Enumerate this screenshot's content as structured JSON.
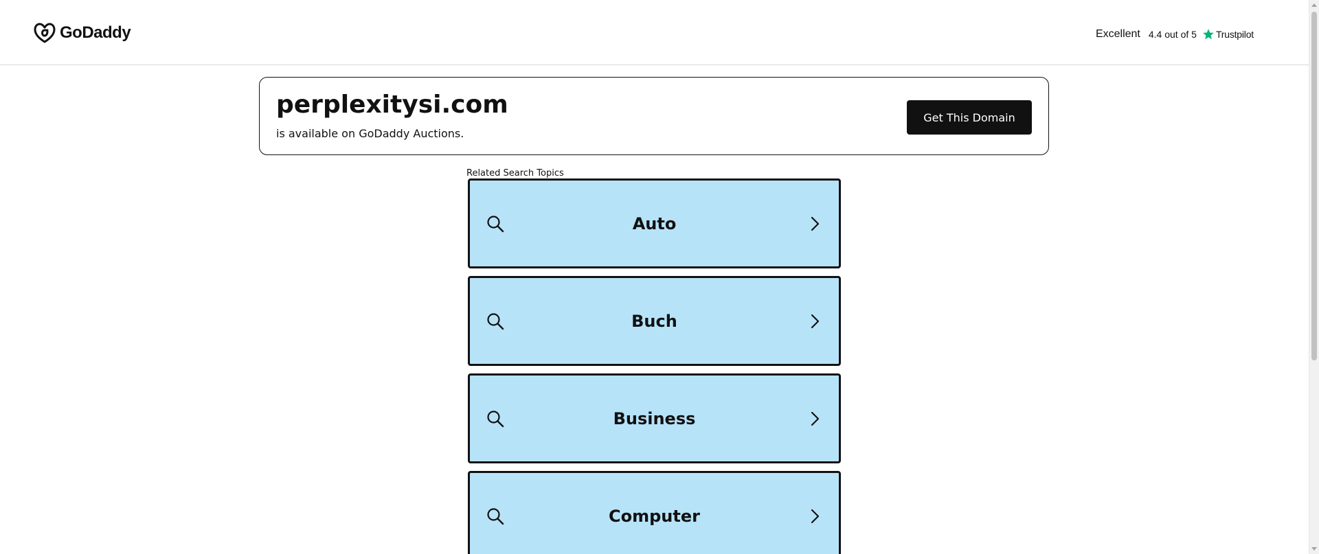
{
  "header": {
    "logo_text": "GoDaddy",
    "trust": {
      "label": "Excellent",
      "rating": "4.4 out of 5",
      "brand": "Trustpilot",
      "star_color": "#00b67a"
    }
  },
  "domain_card": {
    "domain": "perplexitysi.com",
    "subtitle": "is available on GoDaddy Auctions.",
    "button_label": "Get This Domain"
  },
  "related": {
    "label": "Related Search Topics",
    "items": [
      {
        "label": "Auto"
      },
      {
        "label": "Buch"
      },
      {
        "label": "Business"
      },
      {
        "label": "Computer"
      }
    ]
  },
  "colors": {
    "topic_bg": "#b7e3f9",
    "button_bg": "#111111"
  }
}
